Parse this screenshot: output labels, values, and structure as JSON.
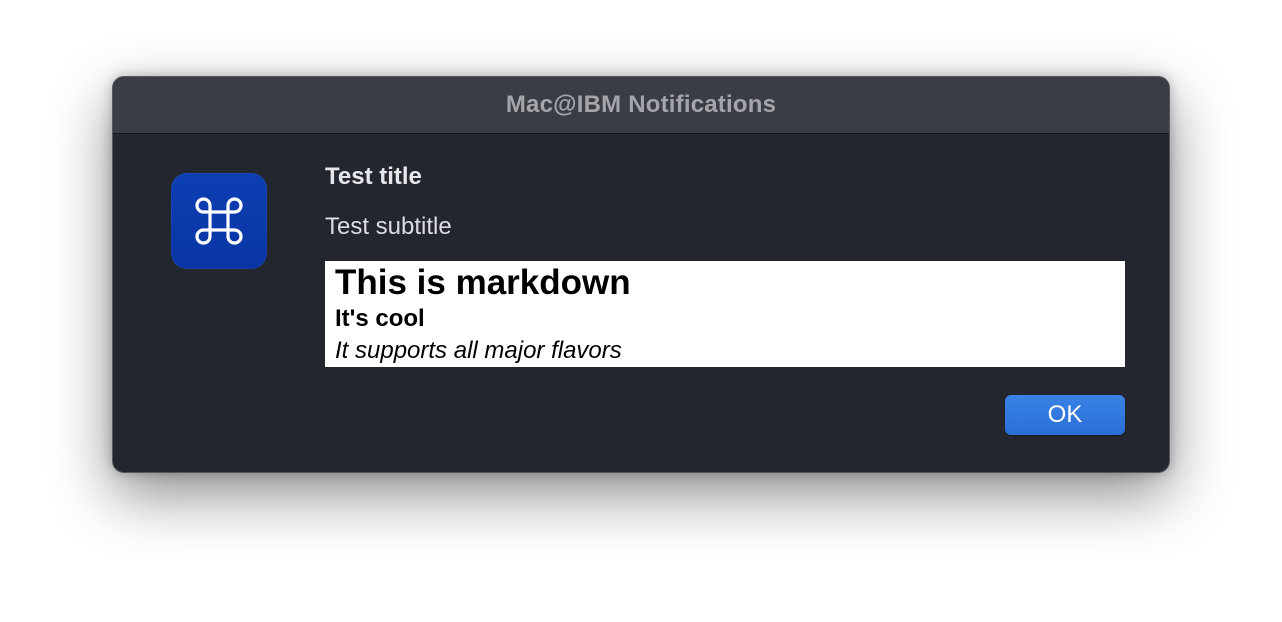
{
  "window": {
    "title": "Mac@IBM Notifications"
  },
  "app_icon": {
    "name": "command-key-icon",
    "background_color": "#0a35a4"
  },
  "notification": {
    "title": "Test title",
    "subtitle": "Test subtitle",
    "markdown": {
      "heading1": "This is markdown",
      "heading2": "It's cool",
      "italic": "It supports all major flavors"
    }
  },
  "buttons": {
    "ok_label": "OK",
    "ok_color": "#2f77dc"
  }
}
